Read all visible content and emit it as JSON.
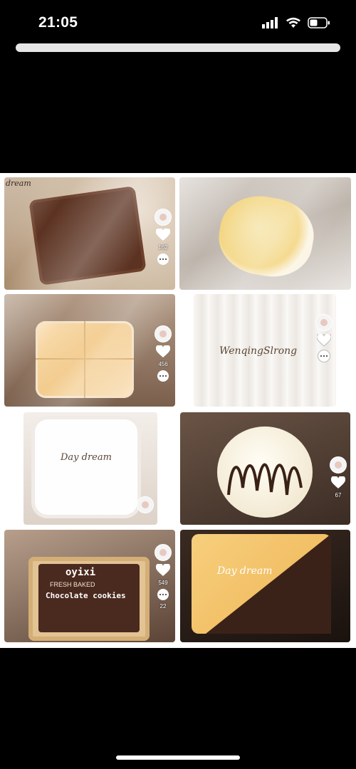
{
  "status_bar": {
    "time": "21:05"
  },
  "tiles": [
    {
      "label": "dream",
      "count1": "162"
    },
    {},
    {
      "count1": "456"
    },
    {
      "label": "WenqingSlrong"
    },
    {
      "label": "Day dream"
    },
    {
      "count1": "67"
    },
    {
      "label": "oyixi",
      "sub1": "FRESH BAKED",
      "sub2": "Chocolate cookies",
      "count1": "549",
      "count2": "22"
    },
    {
      "label": "Day dream"
    }
  ],
  "colors": {
    "background": "#000000",
    "grid_bg": "#ffffff",
    "grabber": "#e6e6e6"
  }
}
